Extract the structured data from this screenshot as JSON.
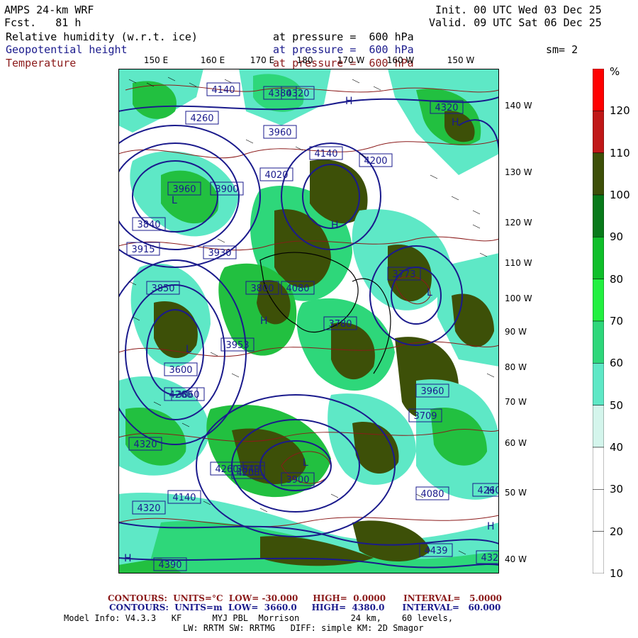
{
  "header": {
    "model": "AMPS 24-km WRF",
    "fcst": "Fcst.   81 h",
    "init": "Init. 00 UTC Wed 03 Dec 25",
    "valid": "Valid. 09 UTC Sat 06 Dec 25",
    "field1": "Relative humidity (w.r.t. ice)",
    "field1_level": "at pressure =  600 hPa",
    "field2": "Geopotential height",
    "field2_level": "at pressure =  600 hPa",
    "smoothing": "sm= 2",
    "field3": "Temperature",
    "field3_level": "at pressure =  600 hPa"
  },
  "colors": {
    "temperature": "#8b1a1a",
    "height": "#1a1a8c",
    "rh_scale": [
      "#ffffff",
      "#ffffff",
      "#ffffff",
      "#d4f5ec",
      "#5ee8c6",
      "#2ed77a",
      "#22f040",
      "#0fbf2a",
      "#087a1a",
      "#3d5008",
      "#c01818",
      "#ff0000"
    ]
  },
  "colorbar": {
    "unit": "%",
    "labels": [
      "120",
      "110",
      "100",
      "90",
      "80",
      "70",
      "60",
      "50",
      "40",
      "30",
      "20",
      "10"
    ]
  },
  "longitude_labels": [
    "150 E",
    "160 E",
    "170 E",
    "180",
    "170 W",
    "160 W",
    "150 W"
  ],
  "latitude_labels": [
    "140 W",
    "130 W",
    "120 W",
    "110 W",
    "100 W",
    "90 W",
    "80 W",
    "70 W",
    "60 W",
    "50 W",
    "40 W"
  ],
  "map_labels": {
    "height_values": [
      "4320",
      "4260",
      "4140",
      "4200",
      "3960",
      "3900",
      "4020",
      "4080",
      "3773",
      "3840",
      "3915",
      "3930",
      "3800",
      "3953",
      "3780",
      "3850",
      "3860",
      "3709",
      "3900",
      "4380",
      "3600",
      "4390",
      "4320",
      "4260",
      "4200",
      "4080",
      "4260",
      "4320",
      "4140",
      "3960",
      "3840",
      "3960",
      "4320",
      "4439",
      "4320",
      "4260",
      "4140"
    ],
    "high_low_markers": [
      "H",
      "H",
      "L",
      "L",
      "H",
      "L",
      "H",
      "L",
      "H",
      "H",
      "H"
    ]
  },
  "footer": {
    "temp_contours": "CONTOURS:  UNITS=°C  LOW= -30.000     HIGH=  0.0000      INTERVAL=   5.0000",
    "height_contours": "CONTOURS:  UNITS=m  LOW=  3660.0     HIGH=  4380.0      INTERVAL=   60.000",
    "model_info": "Model Info: V4.3.3   KF      MYJ PBL  Morrison          24 km,    60 levels,",
    "physics": "LW: RRTM SW: RRTMG   DIFF: simple KM: 2D Smagor"
  }
}
